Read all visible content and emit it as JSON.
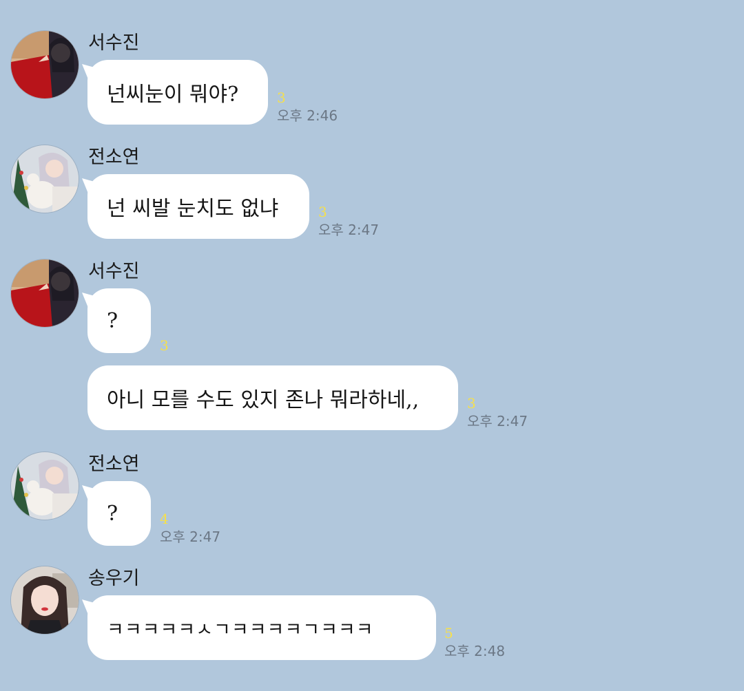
{
  "colors": {
    "background": "#b1c7dc",
    "bubble": "#ffffff",
    "unread": "#f6e04b",
    "time": "#6b7785"
  },
  "messages": [
    {
      "sender": "서수진",
      "avatar": "avatar-seo-sujin",
      "text": "넌씨눈이 뭐야?",
      "unread": "3",
      "time": "오후 2:46"
    },
    {
      "sender": "전소연",
      "avatar": "avatar-jeon-soyeon",
      "text": "넌 씨발 눈치도 없냐",
      "unread": "3",
      "time": "오후 2:47"
    },
    {
      "sender": "서수진",
      "avatar": "avatar-seo-sujin",
      "text": "?",
      "unread": "3",
      "time": ""
    },
    {
      "sender": "",
      "avatar": "",
      "text": "아니 모를 수도 있지 존나 뭐라하네,,",
      "unread": "3",
      "time": "오후 2:47"
    },
    {
      "sender": "전소연",
      "avatar": "avatar-jeon-soyeon",
      "text": "?",
      "unread": "4",
      "time": "오후 2:47"
    },
    {
      "sender": "송우기",
      "avatar": "avatar-song-yuqi",
      "text": "ㅋㅋㅋㅋㅋㅅㄱㅋㅋㅋㅋㄱㅋㅋㅋ",
      "unread": "5",
      "time": "오후 2:48"
    }
  ]
}
